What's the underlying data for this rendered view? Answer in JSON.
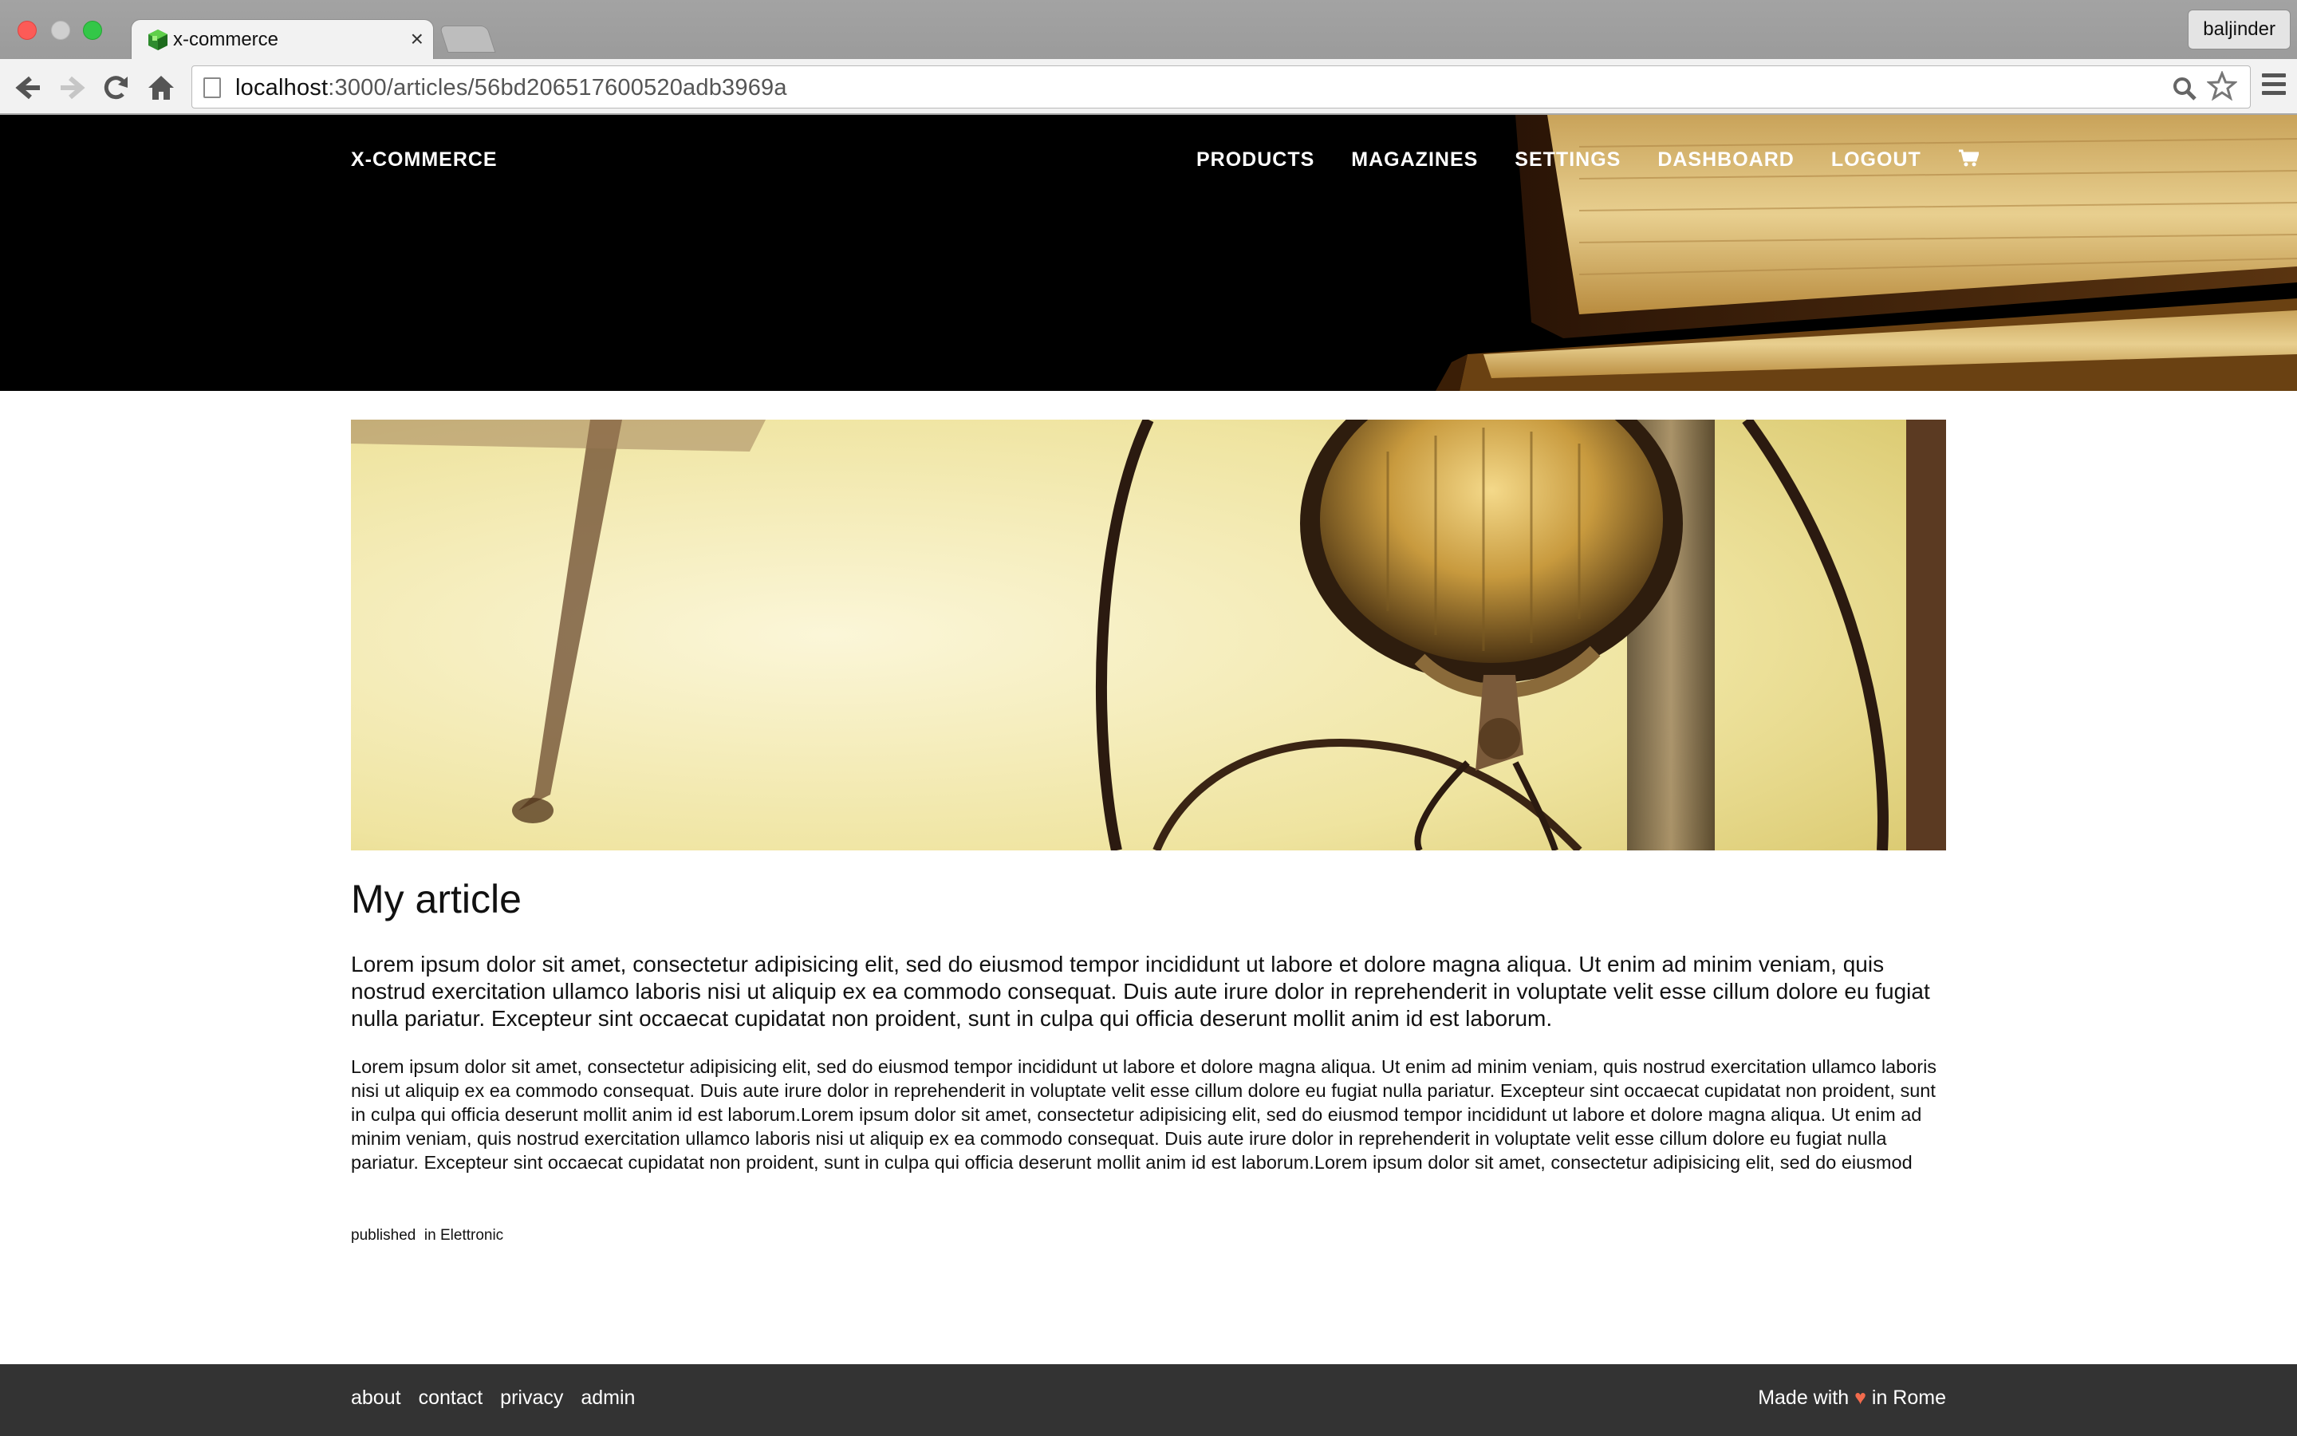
{
  "browser": {
    "tab_title": "x-commerce",
    "tab_close": "×",
    "profile_name": "baljinder",
    "url_host": "localhost",
    "url_rest": ":3000/articles/56bd206517600520adb3969a",
    "icons": {
      "back": "arrow-left-icon",
      "forward": "arrow-right-icon",
      "reload": "reload-icon",
      "home": "home-icon",
      "search": "search-icon",
      "bookmark": "star-icon",
      "menu": "hamburger-menu-icon"
    }
  },
  "header": {
    "brand": "X-COMMERCE",
    "nav": [
      "PRODUCTS",
      "MAGAZINES",
      "SETTINGS",
      "DASHBOARD",
      "LOGOUT"
    ],
    "cart_icon": "cart-icon"
  },
  "article": {
    "title": "My article",
    "lead": "Lorem ipsum dolor sit amet, consectetur adipisicing elit, sed do eiusmod tempor incididunt ut labore et dolore magna aliqua. Ut enim ad minim veniam, quis nostrud exercitation ullamco laboris nisi ut aliquip ex ea commodo consequat. Duis aute irure dolor in reprehenderit in voluptate velit esse cillum dolore eu fugiat nulla pariatur. Excepteur sint occaecat cupidatat non proident, sunt in culpa qui officia deserunt mollit anim id est laborum.",
    "body": "Lorem ipsum dolor sit amet, consectetur adipisicing elit, sed do eiusmod tempor incididunt ut labore et dolore magna aliqua. Ut enim ad minim veniam, quis nostrud exercitation ullamco laboris nisi ut aliquip ex ea commodo consequat. Duis aute irure dolor in reprehenderit in voluptate velit esse cillum dolore eu fugiat nulla pariatur. Excepteur sint occaecat cupidatat non proident, sunt in culpa qui officia deserunt mollit anim id est laborum.Lorem ipsum dolor sit amet, consectetur adipisicing elit, sed do eiusmod tempor incididunt ut labore et dolore magna aliqua. Ut enim ad minim veniam, quis nostrud exercitation ullamco laboris nisi ut aliquip ex ea commodo consequat. Duis aute irure dolor in reprehenderit in voluptate velit esse cillum dolore eu fugiat nulla pariatur. Excepteur sint occaecat cupidatat non proident, sunt in culpa qui officia deserunt mollit anim id est laborum.Lorem ipsum dolor sit amet, consectetur adipisicing elit, sed do eiusmod",
    "meta_published": "published",
    "meta_in": "in",
    "meta_category": "Elettronic"
  },
  "footer": {
    "links": [
      "about",
      "contact",
      "privacy",
      "admin"
    ],
    "made_prefix": "Made with",
    "made_suffix": "in Rome",
    "heart": "♥"
  },
  "colors": {
    "header_bg": "#000000",
    "footer_bg": "#333333",
    "heart": "#f26b4d"
  }
}
